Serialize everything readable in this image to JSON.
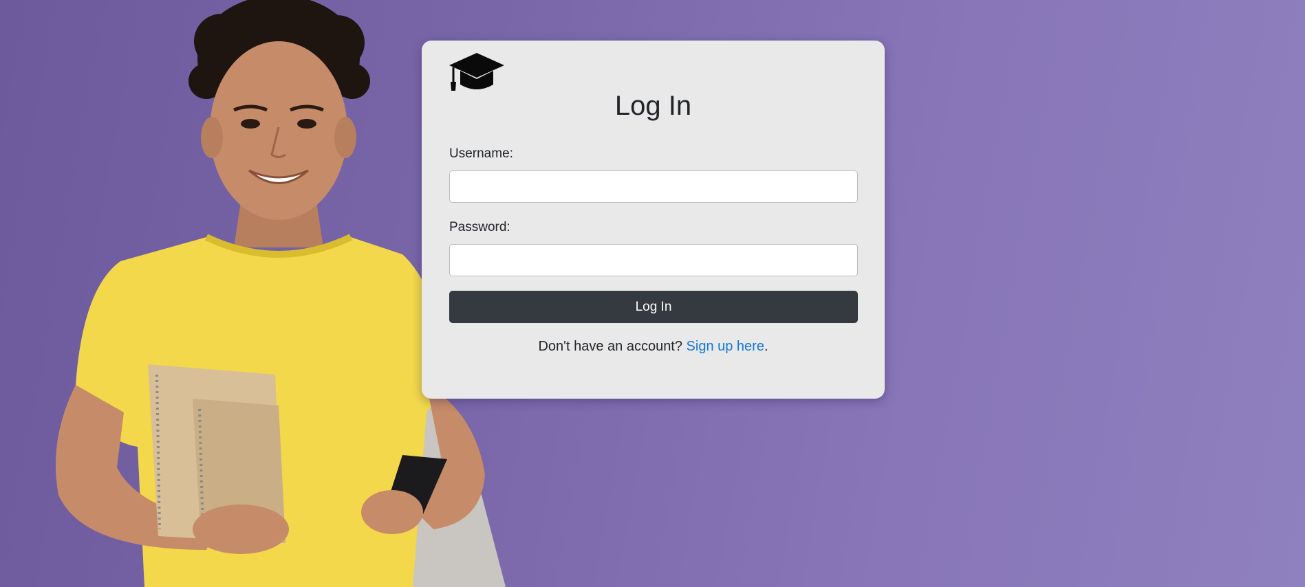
{
  "page": {
    "background_color_start": "#6c5a9c",
    "background_color_end": "#8f80bf"
  },
  "hero_image": {
    "subject": "smiling student in yellow t-shirt holding notebooks and a phone, wearing a backpack"
  },
  "login_card": {
    "logo_icon": "graduation-cap-icon",
    "title": "Log In",
    "username_label": "Username:",
    "username_value": "",
    "password_label": "Password:",
    "password_value": "",
    "submit_label": "Log In",
    "signup_prompt": "Don't have an account? ",
    "signup_link": "Sign up here",
    "signup_suffix": ".",
    "link_color": "#1378d8",
    "button_color": "#353a41"
  }
}
